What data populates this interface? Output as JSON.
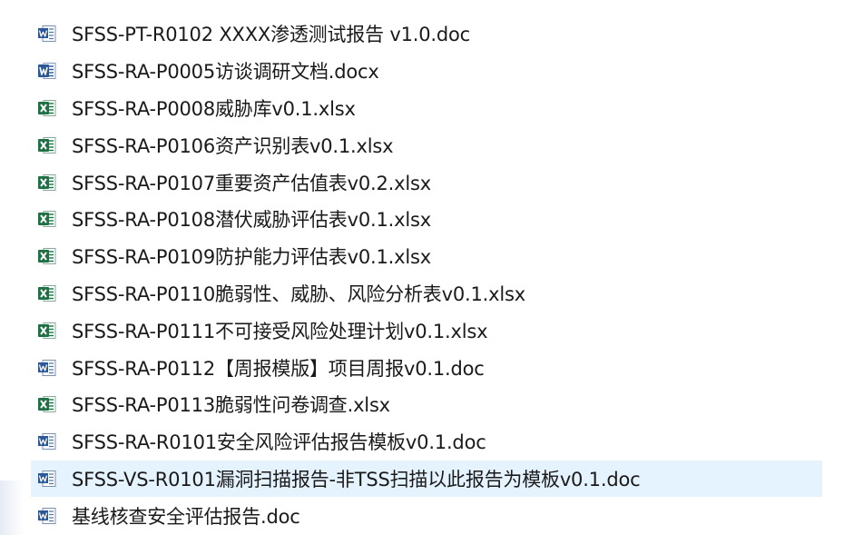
{
  "files": [
    {
      "name": "SFSS-PT-R0102 XXXX渗透测试报告 v1.0.doc",
      "type": "word-doc",
      "selected": false
    },
    {
      "name": "SFSS-RA-P0005访谈调研文档.docx",
      "type": "word-docx",
      "selected": false
    },
    {
      "name": "SFSS-RA-P0008威胁库v0.1.xlsx",
      "type": "excel",
      "selected": false
    },
    {
      "name": "SFSS-RA-P0106资产识别表v0.1.xlsx",
      "type": "excel",
      "selected": false
    },
    {
      "name": "SFSS-RA-P0107重要资产估值表v0.2.xlsx",
      "type": "excel",
      "selected": false
    },
    {
      "name": "SFSS-RA-P0108潜伏威胁评估表v0.1.xlsx",
      "type": "excel",
      "selected": false
    },
    {
      "name": "SFSS-RA-P0109防护能力评估表v0.1.xlsx",
      "type": "excel",
      "selected": false
    },
    {
      "name": "SFSS-RA-P0110脆弱性、威胁、风险分析表v0.1.xlsx",
      "type": "excel",
      "selected": false
    },
    {
      "name": "SFSS-RA-P0111不可接受风险处理计划v0.1.xlsx",
      "type": "excel",
      "selected": false
    },
    {
      "name": "SFSS-RA-P0112【周报模版】项目周报v0.1.doc",
      "type": "word-doc",
      "selected": false
    },
    {
      "name": "SFSS-RA-P0113脆弱性问卷调查.xlsx",
      "type": "excel",
      "selected": false
    },
    {
      "name": "SFSS-RA-R0101安全风险评估报告模板v0.1.doc",
      "type": "word-doc",
      "selected": false
    },
    {
      "name": "SFSS-VS-R0101漏洞扫描报告-非TSS扫描以此报告为模板v0.1.doc",
      "type": "word-doc",
      "selected": true
    },
    {
      "name": "基线核查安全评估报告.doc",
      "type": "word-doc",
      "selected": false
    }
  ],
  "icons": {
    "word-doc": "word-doc-icon",
    "word-docx": "word-docx-icon",
    "excel": "excel-icon"
  },
  "colors": {
    "selection": "#e5f3ff",
    "word_blue": "#2b5797",
    "excel_green": "#1e7145"
  }
}
